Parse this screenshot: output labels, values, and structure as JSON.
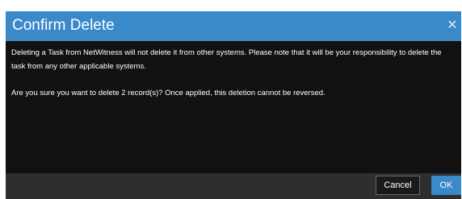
{
  "dialog": {
    "title": "Confirm Delete",
    "close_icon": "close-icon",
    "close_glyph": "✕",
    "message_1": "Deleting a Task from NetWitness will not delete it from other systems. Please note that it will be your responsibility to delete the task from any other applicable systems.",
    "message_2": "Are you sure you want to delete 2 record(s)? Once applied, this deletion cannot be reversed.",
    "cancel_label": "Cancel",
    "ok_label": "OK"
  },
  "colors": {
    "header": "#3a89c9",
    "body": "#111111",
    "footer": "#2e2e2e",
    "primary_button": "#3a89c9"
  }
}
